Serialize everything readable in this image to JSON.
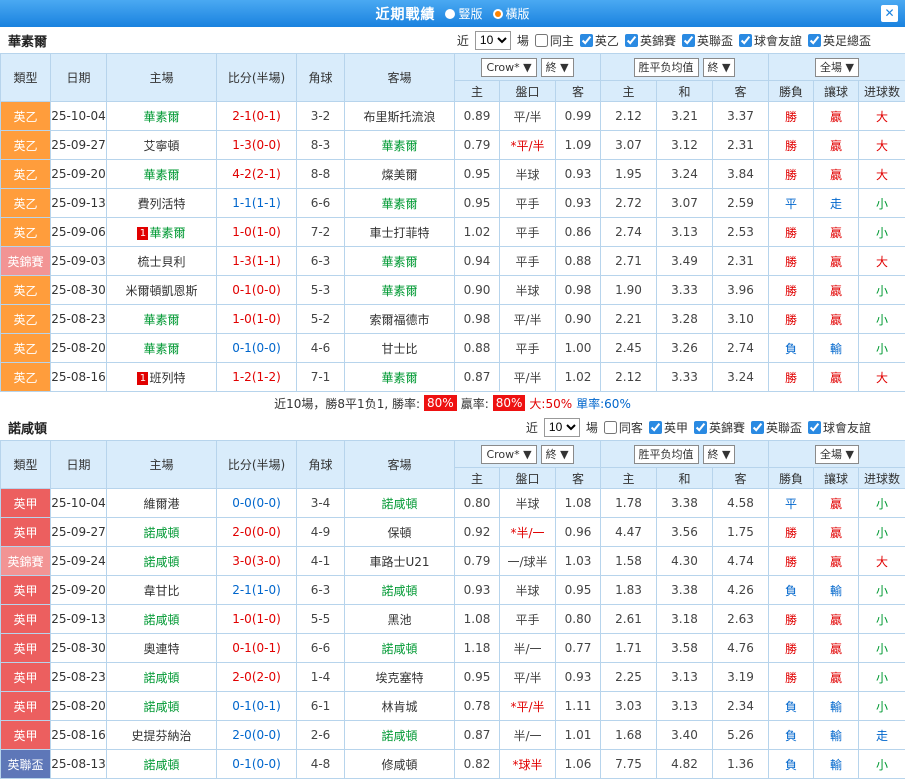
{
  "titlebar": {
    "title": "近期戰績",
    "layout_vertical": "豎版",
    "layout_horizontal": "橫版",
    "selected_layout": "橫版",
    "close_icon": "✕"
  },
  "filter_labels": {
    "near": "近",
    "games": "場"
  },
  "table_header": {
    "type": "類型",
    "date": "日期",
    "home": "主場",
    "score": "比分(半場)",
    "corner": "角球",
    "away": "客場",
    "odds_sub": [
      "主",
      "盤口",
      "客"
    ],
    "avg_sub": [
      "主",
      "和",
      "客"
    ],
    "result_sub": [
      "勝負",
      "讓球",
      "进球数"
    ],
    "crow_select": "Crow*",
    "final_select": "終",
    "avg_label": "胜平负均值",
    "full_select": "全場"
  },
  "colors": {
    "topbar_blue": "#1a82df",
    "radio_selected_dot": "#ff8400",
    "header_bg": "#d9ecfb",
    "grid_border": "#b7d4ec",
    "win_red": "#e10000",
    "draw_blue": "#0066cc",
    "small_green": "#009933",
    "focus_team_green": "#009933",
    "league_palette": {
      "orange": "#ff9d3c",
      "red": "#ec5f5f",
      "salmon": "#f29494",
      "navy": "#5e77b8"
    }
  },
  "sections": [
    {
      "team": "華素爾",
      "near_count": "10",
      "filters": [
        {
          "label": "同主",
          "checked": false
        },
        {
          "label": "英乙",
          "checked": true
        },
        {
          "label": "英錦賽",
          "checked": true
        },
        {
          "label": "英聯盃",
          "checked": true
        },
        {
          "label": "球會友誼",
          "checked": true
        },
        {
          "label": "英足總盃",
          "checked": true
        }
      ],
      "rows": [
        {
          "league": "英乙",
          "league_color": "orange",
          "date": "25-10-04",
          "home": "華素爾",
          "home_focus": true,
          "home_badge": "",
          "score": "2-1(0-1)",
          "score_color": "red",
          "corner": "3-2",
          "away": "布里斯托流浪",
          "away_focus": false,
          "away_badge": "",
          "odds": [
            "0.89",
            "平/半",
            "0.99"
          ],
          "line_red": false,
          "avg": [
            "2.12",
            "3.21",
            "3.37"
          ],
          "result": "勝",
          "result_color": "red",
          "let": "贏",
          "let_color": "red",
          "goals": "大",
          "goals_color": "red"
        },
        {
          "league": "英乙",
          "league_color": "orange",
          "date": "25-09-27",
          "home": "艾寧頓",
          "home_focus": false,
          "home_badge": "",
          "score": "1-3(0-0)",
          "score_color": "red",
          "corner": "8-3",
          "away": "華素爾",
          "away_focus": true,
          "away_badge": "",
          "odds": [
            "0.79",
            "*平/半",
            "1.09"
          ],
          "line_red": true,
          "avg": [
            "3.07",
            "3.12",
            "2.31"
          ],
          "result": "勝",
          "result_color": "red",
          "let": "贏",
          "let_color": "red",
          "goals": "大",
          "goals_color": "red"
        },
        {
          "league": "英乙",
          "league_color": "orange",
          "date": "25-09-20",
          "home": "華素爾",
          "home_focus": true,
          "home_badge": "",
          "score": "4-2(2-1)",
          "score_color": "red",
          "corner": "8-8",
          "away": "燦美爾",
          "away_focus": false,
          "away_badge": "",
          "odds": [
            "0.95",
            "半球",
            "0.93"
          ],
          "line_red": false,
          "avg": [
            "1.95",
            "3.24",
            "3.84"
          ],
          "result": "勝",
          "result_color": "red",
          "let": "贏",
          "let_color": "red",
          "goals": "大",
          "goals_color": "red"
        },
        {
          "league": "英乙",
          "league_color": "orange",
          "date": "25-09-13",
          "home": "費列活特",
          "home_focus": false,
          "home_badge": "",
          "score": "1-1(1-1)",
          "score_color": "blue",
          "corner": "6-6",
          "away": "華素爾",
          "away_focus": true,
          "away_badge": "",
          "odds": [
            "0.95",
            "平手",
            "0.93"
          ],
          "line_red": false,
          "avg": [
            "2.72",
            "3.07",
            "2.59"
          ],
          "result": "平",
          "result_color": "blue",
          "let": "走",
          "let_color": "blue",
          "goals": "小",
          "goals_color": "green"
        },
        {
          "league": "英乙",
          "league_color": "orange",
          "date": "25-09-06",
          "home": "華素爾",
          "home_focus": true,
          "home_badge": "1",
          "score": "1-0(1-0)",
          "score_color": "red",
          "corner": "7-2",
          "away": "車士打菲特",
          "away_focus": false,
          "away_badge": "",
          "odds": [
            "1.02",
            "平手",
            "0.86"
          ],
          "line_red": false,
          "avg": [
            "2.74",
            "3.13",
            "2.53"
          ],
          "result": "勝",
          "result_color": "red",
          "let": "贏",
          "let_color": "red",
          "goals": "小",
          "goals_color": "green"
        },
        {
          "league": "英錦賽",
          "league_color": "salmon",
          "date": "25-09-03",
          "home": "梳士貝利",
          "home_focus": false,
          "home_badge": "",
          "score": "1-3(1-1)",
          "score_color": "red",
          "corner": "6-3",
          "away": "華素爾",
          "away_focus": true,
          "away_badge": "",
          "odds": [
            "0.94",
            "平手",
            "0.88"
          ],
          "line_red": false,
          "avg": [
            "2.71",
            "3.49",
            "2.31"
          ],
          "result": "勝",
          "result_color": "red",
          "let": "贏",
          "let_color": "red",
          "goals": "大",
          "goals_color": "red"
        },
        {
          "league": "英乙",
          "league_color": "orange",
          "date": "25-08-30",
          "home": "米爾頓凱恩斯",
          "home_focus": false,
          "home_badge": "",
          "score": "0-1(0-0)",
          "score_color": "red",
          "corner": "5-3",
          "away": "華素爾",
          "away_focus": true,
          "away_badge": "",
          "odds": [
            "0.90",
            "半球",
            "0.98"
          ],
          "line_red": false,
          "avg": [
            "1.90",
            "3.33",
            "3.96"
          ],
          "result": "勝",
          "result_color": "red",
          "let": "贏",
          "let_color": "red",
          "goals": "小",
          "goals_color": "green"
        },
        {
          "league": "英乙",
          "league_color": "orange",
          "date": "25-08-23",
          "home": "華素爾",
          "home_focus": true,
          "home_badge": "",
          "score": "1-0(1-0)",
          "score_color": "red",
          "corner": "5-2",
          "away": "索爾福德市",
          "away_focus": false,
          "away_badge": "",
          "odds": [
            "0.98",
            "平/半",
            "0.90"
          ],
          "line_red": false,
          "avg": [
            "2.21",
            "3.28",
            "3.10"
          ],
          "result": "勝",
          "result_color": "red",
          "let": "贏",
          "let_color": "red",
          "goals": "小",
          "goals_color": "green"
        },
        {
          "league": "英乙",
          "league_color": "orange",
          "date": "25-08-20",
          "home": "華素爾",
          "home_focus": true,
          "home_badge": "",
          "score": "0-1(0-0)",
          "score_color": "blue",
          "corner": "4-6",
          "away": "甘士比",
          "away_focus": false,
          "away_badge": "",
          "odds": [
            "0.88",
            "平手",
            "1.00"
          ],
          "line_red": false,
          "avg": [
            "2.45",
            "3.26",
            "2.74"
          ],
          "result": "負",
          "result_color": "blue",
          "let": "輸",
          "let_color": "blue",
          "goals": "小",
          "goals_color": "green"
        },
        {
          "league": "英乙",
          "league_color": "orange",
          "date": "25-08-16",
          "home": "班列特",
          "home_focus": false,
          "home_badge": "1",
          "score": "1-2(1-2)",
          "score_color": "red",
          "corner": "7-1",
          "away": "華素爾",
          "away_focus": true,
          "away_badge": "",
          "odds": [
            "0.87",
            "平/半",
            "1.02"
          ],
          "line_red": false,
          "avg": [
            "2.12",
            "3.33",
            "3.24"
          ],
          "result": "勝",
          "result_color": "red",
          "let": "贏",
          "let_color": "red",
          "goals": "大",
          "goals_color": "red"
        }
      ],
      "summary": {
        "prefix": "近10場，勝8平1负1, 勝率:",
        "win_badge": "80%",
        "mid": "贏率:",
        "profit_badge": "80%",
        "big": "大:50%",
        "single": "單率:60%"
      }
    },
    {
      "team": "諾咸頓",
      "near_count": "10",
      "filters": [
        {
          "label": "同客",
          "checked": false
        },
        {
          "label": "英甲",
          "checked": true
        },
        {
          "label": "英錦賽",
          "checked": true
        },
        {
          "label": "英聯盃",
          "checked": true
        },
        {
          "label": "球會友誼",
          "checked": true
        }
      ],
      "rows": [
        {
          "league": "英甲",
          "league_color": "red",
          "date": "25-10-04",
          "home": "維爾港",
          "home_focus": false,
          "home_badge": "",
          "score": "0-0(0-0)",
          "score_color": "blue",
          "corner": "3-4",
          "away": "諾咸頓",
          "away_focus": true,
          "away_badge": "",
          "odds": [
            "0.80",
            "半球",
            "1.08"
          ],
          "line_red": false,
          "avg": [
            "1.78",
            "3.38",
            "4.58"
          ],
          "result": "平",
          "result_color": "blue",
          "let": "贏",
          "let_color": "red",
          "goals": "小",
          "goals_color": "green"
        },
        {
          "league": "英甲",
          "league_color": "red",
          "date": "25-09-27",
          "home": "諾咸頓",
          "home_focus": true,
          "home_badge": "",
          "score": "2-0(0-0)",
          "score_color": "red",
          "corner": "4-9",
          "away": "保頓",
          "away_focus": false,
          "away_badge": "",
          "odds": [
            "0.92",
            "*半/一",
            "0.96"
          ],
          "line_red": true,
          "avg": [
            "4.47",
            "3.56",
            "1.75"
          ],
          "result": "勝",
          "result_color": "red",
          "let": "贏",
          "let_color": "red",
          "goals": "小",
          "goals_color": "green"
        },
        {
          "league": "英錦賽",
          "league_color": "salmon",
          "date": "25-09-24",
          "home": "諾咸頓",
          "home_focus": true,
          "home_badge": "",
          "score": "3-0(3-0)",
          "score_color": "red",
          "corner": "4-1",
          "away": "車路士U21",
          "away_focus": false,
          "away_badge": "",
          "odds": [
            "0.79",
            "一/球半",
            "1.03"
          ],
          "line_red": false,
          "avg": [
            "1.58",
            "4.30",
            "4.74"
          ],
          "result": "勝",
          "result_color": "red",
          "let": "贏",
          "let_color": "red",
          "goals": "大",
          "goals_color": "red"
        },
        {
          "league": "英甲",
          "league_color": "red",
          "date": "25-09-20",
          "home": "韋甘比",
          "home_focus": false,
          "home_badge": "",
          "score": "2-1(1-0)",
          "score_color": "blue",
          "corner": "6-3",
          "away": "諾咸頓",
          "away_focus": true,
          "away_badge": "",
          "odds": [
            "0.93",
            "半球",
            "0.95"
          ],
          "line_red": false,
          "avg": [
            "1.83",
            "3.38",
            "4.26"
          ],
          "result": "負",
          "result_color": "blue",
          "let": "輸",
          "let_color": "blue",
          "goals": "小",
          "goals_color": "green"
        },
        {
          "league": "英甲",
          "league_color": "red",
          "date": "25-09-13",
          "home": "諾咸頓",
          "home_focus": true,
          "home_badge": "",
          "score": "1-0(1-0)",
          "score_color": "red",
          "corner": "5-5",
          "away": "黑池",
          "away_focus": false,
          "away_badge": "",
          "odds": [
            "1.08",
            "平手",
            "0.80"
          ],
          "line_red": false,
          "avg": [
            "2.61",
            "3.18",
            "2.63"
          ],
          "result": "勝",
          "result_color": "red",
          "let": "贏",
          "let_color": "red",
          "goals": "小",
          "goals_color": "green"
        },
        {
          "league": "英甲",
          "league_color": "red",
          "date": "25-08-30",
          "home": "奧連特",
          "home_focus": false,
          "home_badge": "",
          "score": "0-1(0-1)",
          "score_color": "red",
          "corner": "6-6",
          "away": "諾咸頓",
          "away_focus": true,
          "away_badge": "",
          "odds": [
            "1.18",
            "半/一",
            "0.77"
          ],
          "line_red": false,
          "avg": [
            "1.71",
            "3.58",
            "4.76"
          ],
          "result": "勝",
          "result_color": "red",
          "let": "贏",
          "let_color": "red",
          "goals": "小",
          "goals_color": "green"
        },
        {
          "league": "英甲",
          "league_color": "red",
          "date": "25-08-23",
          "home": "諾咸頓",
          "home_focus": true,
          "home_badge": "",
          "score": "2-0(2-0)",
          "score_color": "red",
          "corner": "1-4",
          "away": "埃克塞特",
          "away_focus": false,
          "away_badge": "",
          "odds": [
            "0.95",
            "平/半",
            "0.93"
          ],
          "line_red": false,
          "avg": [
            "2.25",
            "3.13",
            "3.19"
          ],
          "result": "勝",
          "result_color": "red",
          "let": "贏",
          "let_color": "red",
          "goals": "小",
          "goals_color": "green"
        },
        {
          "league": "英甲",
          "league_color": "red",
          "date": "25-08-20",
          "home": "諾咸頓",
          "home_focus": true,
          "home_badge": "",
          "score": "0-1(0-1)",
          "score_color": "blue",
          "corner": "6-1",
          "away": "林肯城",
          "away_focus": false,
          "away_badge": "",
          "odds": [
            "0.78",
            "*平/半",
            "1.11"
          ],
          "line_red": true,
          "avg": [
            "3.03",
            "3.13",
            "2.34"
          ],
          "result": "負",
          "result_color": "blue",
          "let": "輸",
          "let_color": "blue",
          "goals": "小",
          "goals_color": "green"
        },
        {
          "league": "英甲",
          "league_color": "red",
          "date": "25-08-16",
          "home": "史提芬納治",
          "home_focus": false,
          "home_badge": "",
          "score": "2-0(0-0)",
          "score_color": "blue",
          "corner": "2-6",
          "away": "諾咸頓",
          "away_focus": true,
          "away_badge": "",
          "odds": [
            "0.87",
            "半/一",
            "1.01"
          ],
          "line_red": false,
          "avg": [
            "1.68",
            "3.40",
            "5.26"
          ],
          "result": "負",
          "result_color": "blue",
          "let": "輸",
          "let_color": "blue",
          "goals": "走",
          "goals_color": "blue"
        },
        {
          "league": "英聯盃",
          "league_color": "navy",
          "date": "25-08-13",
          "home": "諾咸頓",
          "home_focus": true,
          "home_badge": "",
          "score": "0-1(0-0)",
          "score_color": "blue",
          "corner": "4-8",
          "away": "修咸頓",
          "away_focus": false,
          "away_badge": "",
          "odds": [
            "0.82",
            "*球半",
            "1.06"
          ],
          "line_red": true,
          "avg": [
            "7.75",
            "4.82",
            "1.36"
          ],
          "result": "負",
          "result_color": "blue",
          "let": "輸",
          "let_color": "blue",
          "goals": "小",
          "goals_color": "green"
        }
      ],
      "summary": null
    }
  ]
}
